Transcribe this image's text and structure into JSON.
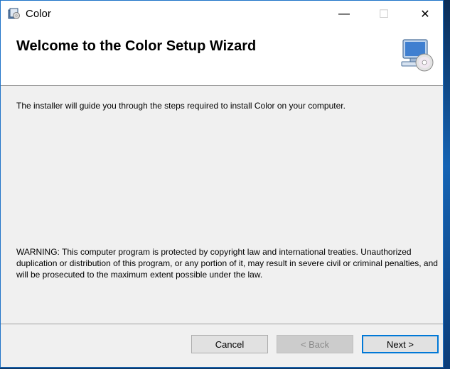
{
  "window": {
    "title": "Color"
  },
  "header": {
    "title": "Welcome to the Color Setup Wizard"
  },
  "body": {
    "intro": "The installer will guide you through the steps required to install Color on your computer.",
    "warning": "WARNING: This computer program is protected by copyright law and international treaties. Unauthorized duplication or distribution of this program, or any portion of it, may result in severe civil or criminal penalties, and will be prosecuted to the maximum extent possible under the law."
  },
  "footer": {
    "cancel_label": "Cancel",
    "back_label": "< Back",
    "next_label": "Next >"
  },
  "controls": {
    "minimize_glyph": "—",
    "maximize_glyph": "☐",
    "close_glyph": "✕"
  },
  "colors": {
    "accent": "#0078d7"
  }
}
